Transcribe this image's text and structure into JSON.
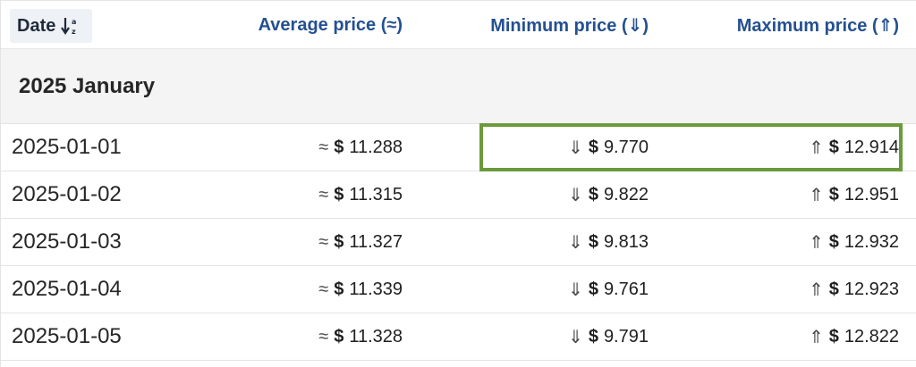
{
  "header": {
    "date_label": "Date",
    "avg_label": "Average price (≈)",
    "min_label": "Minimum price (⇓)",
    "max_label": "Maximum price (⇑)"
  },
  "group": {
    "label": "2025 January"
  },
  "symbols": {
    "avg": "≈",
    "min": "⇓",
    "max": "⇑",
    "currency": "$"
  },
  "rows": [
    {
      "date": "2025-01-01",
      "avg": "11.288",
      "min": "9.770",
      "max": "12.914"
    },
    {
      "date": "2025-01-02",
      "avg": "11.315",
      "min": "9.822",
      "max": "12.951"
    },
    {
      "date": "2025-01-03",
      "avg": "11.327",
      "min": "9.813",
      "max": "12.932"
    },
    {
      "date": "2025-01-04",
      "avg": "11.339",
      "min": "9.761",
      "max": "12.923"
    },
    {
      "date": "2025-01-05",
      "avg": "11.328",
      "min": "9.791",
      "max": "12.822"
    }
  ],
  "highlight_color": "#6b9a3c",
  "link_color": "#245092"
}
